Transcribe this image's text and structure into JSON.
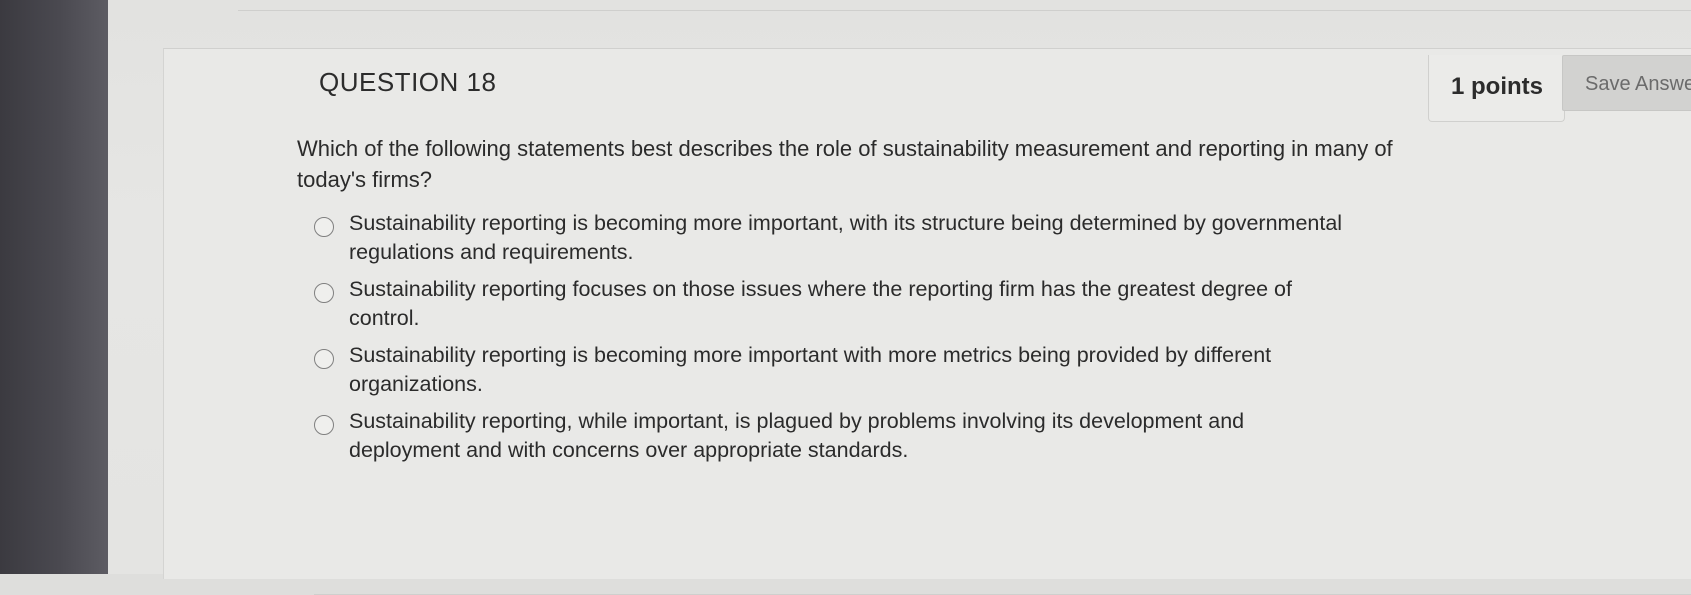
{
  "question": {
    "number_label": "QUESTION 18",
    "points_label": "1 points",
    "save_label": "Save Answer",
    "text": "Which of the following statements best describes the role of sustainability measurement and reporting in many of today's firms?",
    "options": [
      {
        "label": "Sustainability reporting is becoming more important, with its structure being determined by governmental regulations and requirements."
      },
      {
        "label": "Sustainability reporting focuses on those issues where the reporting firm has the greatest degree of control."
      },
      {
        "label": "Sustainability reporting is becoming more important with more metrics being provided by different organizations."
      },
      {
        "label": "Sustainability reporting, while important, is plagued by problems involving its development and deployment and with concerns over appropriate standards."
      }
    ]
  }
}
